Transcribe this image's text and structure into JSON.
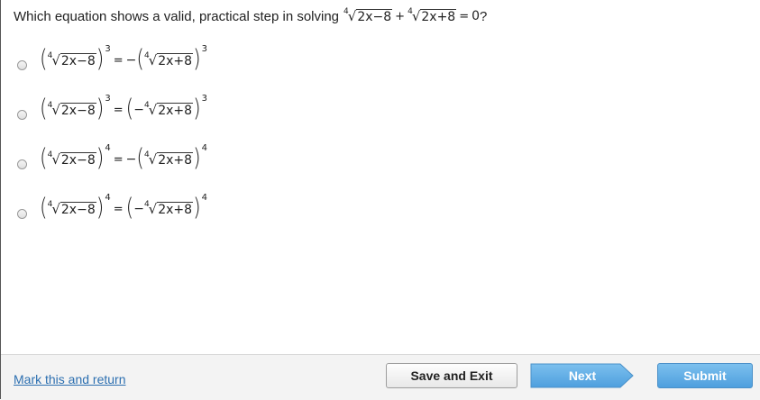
{
  "question": {
    "prefix": "Which equation shows a valid, practical step in solving",
    "expr": {
      "root1_index": "4",
      "root1_rad": "2x−8",
      "plus": "+",
      "root2_index": "4",
      "root2_rad": "2x+8",
      "eq": "=",
      "rhs": "0"
    },
    "suffix": "?"
  },
  "choices": [
    {
      "lhs_index": "4",
      "lhs_rad": "2x−8",
      "lhs_exp": "3",
      "eq": "=",
      "rhs_sign": "−",
      "rhs_inner_sign": "",
      "rhs_index": "4",
      "rhs_rad": "2x+8",
      "rhs_exp": "3"
    },
    {
      "lhs_index": "4",
      "lhs_rad": "2x−8",
      "lhs_exp": "3",
      "eq": "=",
      "rhs_sign": "",
      "rhs_inner_sign": "−",
      "rhs_index": "4",
      "rhs_rad": "2x+8",
      "rhs_exp": "3"
    },
    {
      "lhs_index": "4",
      "lhs_rad": "2x−8",
      "lhs_exp": "4",
      "eq": "=",
      "rhs_sign": "−",
      "rhs_inner_sign": "",
      "rhs_index": "4",
      "rhs_rad": "2x+8",
      "rhs_exp": "4"
    },
    {
      "lhs_index": "4",
      "lhs_rad": "2x−8",
      "lhs_exp": "4",
      "eq": "=",
      "rhs_sign": "",
      "rhs_inner_sign": "−",
      "rhs_index": "4",
      "rhs_rad": "2x+8",
      "rhs_exp": "4"
    }
  ],
  "footer": {
    "mark_link": "Mark this and return",
    "save_label": "Save and Exit",
    "next_label": "Next",
    "submit_label": "Submit"
  },
  "colors": {
    "link": "#2c6fb0",
    "next_bg": "#5aa7e0",
    "submit_bg": "#5ea9e2"
  }
}
